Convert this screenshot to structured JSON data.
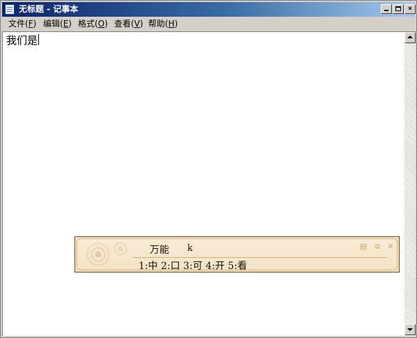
{
  "window": {
    "title": "无标题 - 记事本",
    "buttons": {
      "minimize": "",
      "maximize": "",
      "close": "×"
    }
  },
  "menu": [
    {
      "text": "文件(",
      "key": "F",
      "end": ")"
    },
    {
      "text": "编辑(",
      "key": "E",
      "end": ")"
    },
    {
      "text": "格式(",
      "key": "O",
      "end": ")"
    },
    {
      "text": "查看(",
      "key": "V",
      "end": ")"
    },
    {
      "text": "帮助(",
      "key": "H",
      "end": ")"
    }
  ],
  "editor": {
    "content": "我们是"
  },
  "ime": {
    "name": "万能",
    "input": "k",
    "candidates": "1:中 2:口 3:可 4:开 5:看",
    "icons": [
      "page-icon",
      "copy-icon",
      "close-icon"
    ],
    "icon_glyphs": [
      "▤",
      "⧉",
      "✕"
    ]
  }
}
